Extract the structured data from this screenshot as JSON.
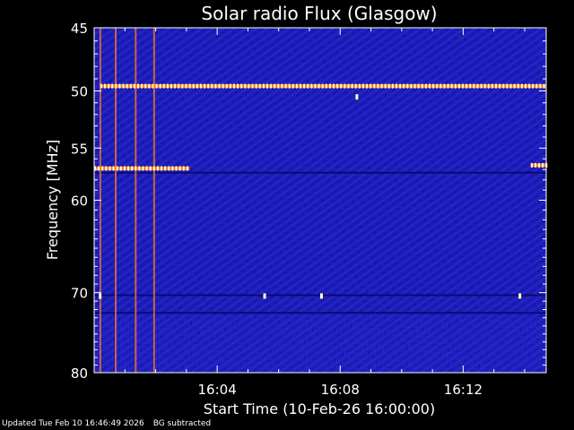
{
  "chart_data": {
    "type": "heatmap",
    "title": "Solar radio Flux (Glasgow)",
    "xlabel": "Start Time (10-Feb-26 16:00:00)",
    "ylabel": "Frequency [MHz]",
    "x_range_minutes": [
      0,
      14.7
    ],
    "y_range_mhz": [
      45,
      80
    ],
    "y_scale": "log",
    "x_ticks": [
      {
        "minute": 4,
        "label": "16:04"
      },
      {
        "minute": 8,
        "label": "16:08"
      },
      {
        "minute": 12,
        "label": "16:12"
      }
    ],
    "y_ticks": [
      {
        "mhz": 45,
        "label": "45"
      },
      {
        "mhz": 50,
        "label": "50"
      },
      {
        "mhz": 55,
        "label": "55"
      },
      {
        "mhz": 60,
        "label": "60"
      },
      {
        "mhz": 70,
        "label": "70"
      },
      {
        "mhz": 80,
        "label": "80"
      }
    ],
    "background_color": "#1a1ab4",
    "emission_color": "#ff7a1a",
    "hot_color": "#ffffcc",
    "bands": [
      {
        "mhz": 49.6,
        "x_start": 0.2,
        "x_end": 14.7,
        "intensity": "strong"
      },
      {
        "mhz": 56.9,
        "x_start": 0.0,
        "x_end": 3.1,
        "intensity": "strong"
      },
      {
        "mhz": 56.6,
        "x_start": 14.2,
        "x_end": 14.7,
        "intensity": "strong"
      }
    ],
    "vertical_streaks_minutes": [
      0.2,
      0.7,
      1.35,
      1.95
    ]
  },
  "footer": {
    "updated": "Updated Tue Feb 10 16:46:49 2026",
    "note": "BG subtracted"
  }
}
